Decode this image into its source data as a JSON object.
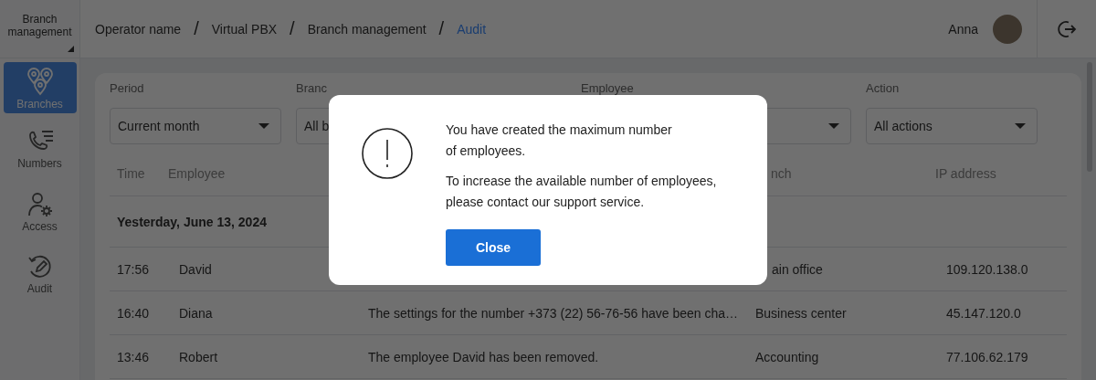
{
  "sidebar": {
    "title": "Branch management",
    "items": [
      {
        "label": "Branches",
        "selected": true
      },
      {
        "label": "Numbers",
        "selected": false
      },
      {
        "label": "Access",
        "selected": false
      },
      {
        "label": "Audit",
        "selected": false
      }
    ]
  },
  "breadcrumb": {
    "items": [
      {
        "label": "Operator name",
        "current": false
      },
      {
        "label": "Virtual PBX",
        "current": false
      },
      {
        "label": "Branch management",
        "current": false
      },
      {
        "label": "Audit",
        "current": true
      }
    ],
    "separators": [
      "/",
      "/",
      "/"
    ]
  },
  "user": {
    "name": "Anna"
  },
  "filters": [
    {
      "label": "Period",
      "value": "Current month"
    },
    {
      "label": "Branc",
      "value": "All b"
    },
    {
      "label": "Employee"
    },
    {
      "label": "Action",
      "value": "All actions"
    }
  ],
  "table": {
    "columns": [
      "Time",
      "Employee",
      "nch",
      "IP address"
    ],
    "group": "Yesterday, June 13, 2024",
    "rows": [
      {
        "time": "17:56",
        "employee": "David",
        "branch": "ain office",
        "ip": "109.120.138.0"
      },
      {
        "time": "16:40",
        "employee": "Diana",
        "action": "The settings for the number +373 (22) 56-76-56 have been cha…",
        "branch": "Business center",
        "ip": "45.147.120.0"
      },
      {
        "time": "13:46",
        "employee": "Robert",
        "action": "The employee David has been removed.",
        "branch": "Accounting",
        "ip": "77.106.62.179"
      }
    ]
  },
  "dialog": {
    "paragraphs": [
      [
        "You have created the maximum number",
        "of employees."
      ],
      [
        "To increase the available number of employees,",
        "please contact our support service."
      ]
    ],
    "button": "Close"
  }
}
